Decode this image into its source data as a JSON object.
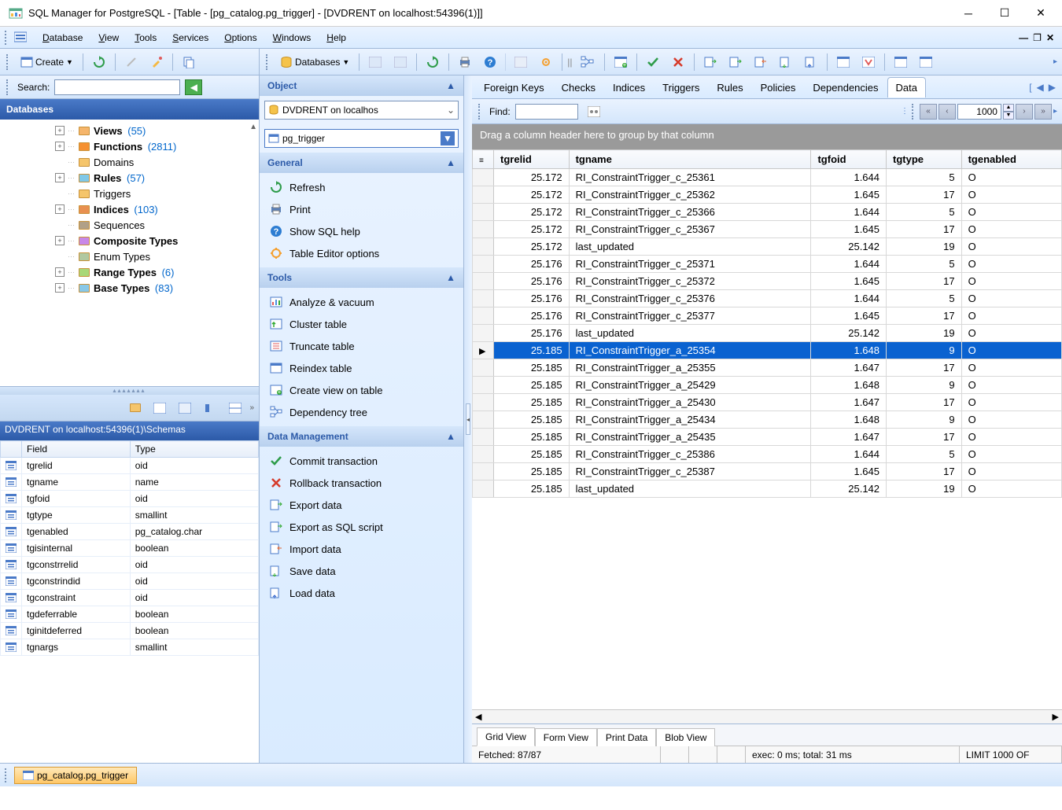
{
  "titlebar": {
    "title": "SQL Manager for PostgreSQL - [Table - [pg_catalog.pg_trigger] - [DVDRENT on localhost:54396(1)]]"
  },
  "menu": {
    "database": "Database",
    "view": "View",
    "tools": "Tools",
    "services": "Services",
    "options": "Options",
    "windows": "Windows",
    "help": "Help"
  },
  "toolbar_left": {
    "create": "Create"
  },
  "toolbar_right": {
    "databases": "Databases"
  },
  "search": {
    "label": "Search:"
  },
  "left_panel": {
    "header": "Databases",
    "tree": [
      {
        "label": "Views",
        "count": "(55)",
        "bold": true,
        "exp": "+"
      },
      {
        "label": "Functions",
        "count": "(2811)",
        "bold": true,
        "exp": "+"
      },
      {
        "label": "Domains",
        "count": "",
        "bold": false,
        "exp": ""
      },
      {
        "label": "Rules",
        "count": "(57)",
        "bold": true,
        "exp": "+"
      },
      {
        "label": "Triggers",
        "count": "",
        "bold": false,
        "exp": ""
      },
      {
        "label": "Indices",
        "count": "(103)",
        "bold": true,
        "exp": "+"
      },
      {
        "label": "Sequences",
        "count": "",
        "bold": false,
        "exp": ""
      },
      {
        "label": "Composite Types",
        "count": "",
        "bold": true,
        "exp": "+"
      },
      {
        "label": "Enum Types",
        "count": "",
        "bold": false,
        "exp": ""
      },
      {
        "label": "Range Types",
        "count": "(6)",
        "bold": true,
        "exp": "+"
      },
      {
        "label": "Base Types",
        "count": "(83)",
        "bold": true,
        "exp": "+"
      }
    ],
    "breadcrumb": "DVDRENT on localhost:54396(1)\\Schemas",
    "fields_header": {
      "field": "Field",
      "type": "Type"
    },
    "fields": [
      {
        "field": "tgrelid",
        "type": "oid"
      },
      {
        "field": "tgname",
        "type": "name"
      },
      {
        "field": "tgfoid",
        "type": "oid"
      },
      {
        "field": "tgtype",
        "type": "smallint"
      },
      {
        "field": "tgenabled",
        "type": "pg_catalog.char"
      },
      {
        "field": "tgisinternal",
        "type": "boolean"
      },
      {
        "field": "tgconstrrelid",
        "type": "oid"
      },
      {
        "field": "tgconstrindid",
        "type": "oid"
      },
      {
        "field": "tgconstraint",
        "type": "oid"
      },
      {
        "field": "tgdeferrable",
        "type": "boolean"
      },
      {
        "field": "tginitdeferred",
        "type": "boolean"
      },
      {
        "field": "tgnargs",
        "type": "smallint"
      }
    ]
  },
  "center": {
    "object_hdr": "Object",
    "db_combo": "DVDRENT on localhos",
    "obj_combo": "pg_trigger",
    "general_hdr": "General",
    "general": [
      "Refresh",
      "Print",
      "Show SQL help",
      "Table Editor options"
    ],
    "tools_hdr": "Tools",
    "tools": [
      "Analyze & vacuum",
      "Cluster table",
      "Truncate table",
      "Reindex table",
      "Create view on table",
      "Dependency tree"
    ],
    "data_hdr": "Data Management",
    "data_mgmt": [
      "Commit transaction",
      "Rollback transaction",
      "Export data",
      "Export as SQL script",
      "Import data",
      "Save data",
      "Load data"
    ]
  },
  "right": {
    "tabs": [
      "Foreign Keys",
      "Checks",
      "Indices",
      "Triggers",
      "Rules",
      "Policies",
      "Dependencies",
      "Data"
    ],
    "active_tab": 7,
    "find_label": "Find:",
    "page": "1000",
    "group_hint": "Drag a column header here to group by that column",
    "columns": [
      "tgrelid",
      "tgname",
      "tgfoid",
      "tgtype",
      "tgenabled"
    ],
    "rows": [
      {
        "sel": false,
        "tgrelid": "25.172",
        "tgname": "RI_ConstraintTrigger_c_25361",
        "tgfoid": "1.644",
        "tgtype": "5",
        "tgenabled": "O"
      },
      {
        "sel": false,
        "tgrelid": "25.172",
        "tgname": "RI_ConstraintTrigger_c_25362",
        "tgfoid": "1.645",
        "tgtype": "17",
        "tgenabled": "O"
      },
      {
        "sel": false,
        "tgrelid": "25.172",
        "tgname": "RI_ConstraintTrigger_c_25366",
        "tgfoid": "1.644",
        "tgtype": "5",
        "tgenabled": "O"
      },
      {
        "sel": false,
        "tgrelid": "25.172",
        "tgname": "RI_ConstraintTrigger_c_25367",
        "tgfoid": "1.645",
        "tgtype": "17",
        "tgenabled": "O"
      },
      {
        "sel": false,
        "tgrelid": "25.172",
        "tgname": "last_updated",
        "tgfoid": "25.142",
        "tgtype": "19",
        "tgenabled": "O"
      },
      {
        "sel": false,
        "tgrelid": "25.176",
        "tgname": "RI_ConstraintTrigger_c_25371",
        "tgfoid": "1.644",
        "tgtype": "5",
        "tgenabled": "O"
      },
      {
        "sel": false,
        "tgrelid": "25.176",
        "tgname": "RI_ConstraintTrigger_c_25372",
        "tgfoid": "1.645",
        "tgtype": "17",
        "tgenabled": "O"
      },
      {
        "sel": false,
        "tgrelid": "25.176",
        "tgname": "RI_ConstraintTrigger_c_25376",
        "tgfoid": "1.644",
        "tgtype": "5",
        "tgenabled": "O"
      },
      {
        "sel": false,
        "tgrelid": "25.176",
        "tgname": "RI_ConstraintTrigger_c_25377",
        "tgfoid": "1.645",
        "tgtype": "17",
        "tgenabled": "O"
      },
      {
        "sel": false,
        "tgrelid": "25.176",
        "tgname": "last_updated",
        "tgfoid": "25.142",
        "tgtype": "19",
        "tgenabled": "O"
      },
      {
        "sel": true,
        "tgrelid": "25.185",
        "tgname": "RI_ConstraintTrigger_a_25354",
        "tgfoid": "1.648",
        "tgtype": "9",
        "tgenabled": "O"
      },
      {
        "sel": false,
        "tgrelid": "25.185",
        "tgname": "RI_ConstraintTrigger_a_25355",
        "tgfoid": "1.647",
        "tgtype": "17",
        "tgenabled": "O"
      },
      {
        "sel": false,
        "tgrelid": "25.185",
        "tgname": "RI_ConstraintTrigger_a_25429",
        "tgfoid": "1.648",
        "tgtype": "9",
        "tgenabled": "O"
      },
      {
        "sel": false,
        "tgrelid": "25.185",
        "tgname": "RI_ConstraintTrigger_a_25430",
        "tgfoid": "1.647",
        "tgtype": "17",
        "tgenabled": "O"
      },
      {
        "sel": false,
        "tgrelid": "25.185",
        "tgname": "RI_ConstraintTrigger_a_25434",
        "tgfoid": "1.648",
        "tgtype": "9",
        "tgenabled": "O"
      },
      {
        "sel": false,
        "tgrelid": "25.185",
        "tgname": "RI_ConstraintTrigger_a_25435",
        "tgfoid": "1.647",
        "tgtype": "17",
        "tgenabled": "O"
      },
      {
        "sel": false,
        "tgrelid": "25.185",
        "tgname": "RI_ConstraintTrigger_c_25386",
        "tgfoid": "1.644",
        "tgtype": "5",
        "tgenabled": "O"
      },
      {
        "sel": false,
        "tgrelid": "25.185",
        "tgname": "RI_ConstraintTrigger_c_25387",
        "tgfoid": "1.645",
        "tgtype": "17",
        "tgenabled": "O"
      },
      {
        "sel": false,
        "tgrelid": "25.185",
        "tgname": "last_updated",
        "tgfoid": "25.142",
        "tgtype": "19",
        "tgenabled": "O"
      }
    ],
    "view_tabs": [
      "Grid View",
      "Form View",
      "Print Data",
      "Blob View"
    ],
    "status_fetched": "Fetched: 87/87",
    "status_exec": "exec: 0 ms; total: 31 ms",
    "status_limit": "LIMIT 1000 OF"
  },
  "bottom": {
    "tab": "pg_catalog.pg_trigger"
  }
}
